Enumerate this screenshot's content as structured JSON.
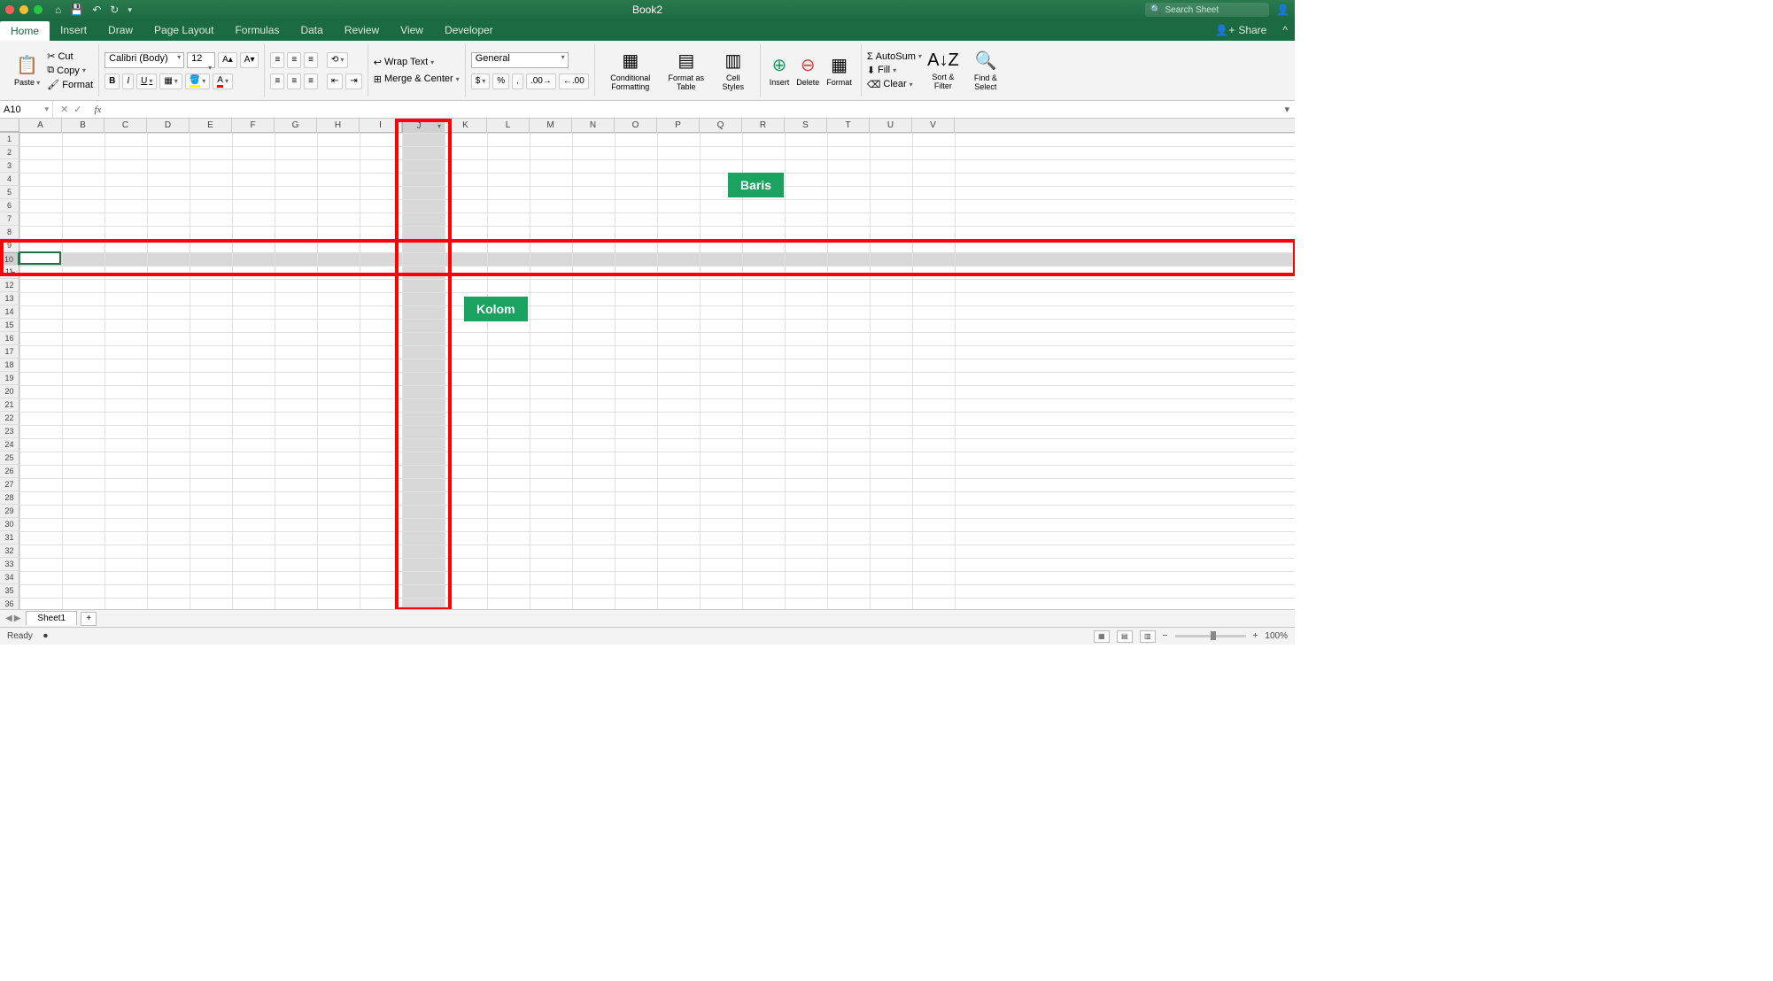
{
  "title": "Book2",
  "search_placeholder": "Search Sheet",
  "menu_tabs": [
    "Home",
    "Insert",
    "Draw",
    "Page Layout",
    "Formulas",
    "Data",
    "Review",
    "View",
    "Developer"
  ],
  "active_tab": "Home",
  "share_label": "Share",
  "clipboard": {
    "paste": "Paste",
    "cut": "Cut",
    "copy": "Copy",
    "format": "Format"
  },
  "font": {
    "name": "Calibri (Body)",
    "size": "12",
    "bold": "B",
    "italic": "I",
    "underline": "U"
  },
  "alignment": {
    "wrap": "Wrap Text",
    "merge": "Merge & Center"
  },
  "number": {
    "format": "General"
  },
  "styles": {
    "cond": "Conditional Formatting",
    "table": "Format as Table",
    "cell": "Cell Styles"
  },
  "cells_grp": {
    "insert": "Insert",
    "delete": "Delete",
    "format": "Format"
  },
  "editing": {
    "autosum": "AutoSum",
    "fill": "Fill",
    "clear": "Clear",
    "sort": "Sort & Filter",
    "find": "Find & Select"
  },
  "namebox": "A10",
  "fx": "fx",
  "columns": [
    "A",
    "B",
    "C",
    "D",
    "E",
    "F",
    "G",
    "H",
    "I",
    "J",
    "K",
    "L",
    "M",
    "N",
    "O",
    "P",
    "Q",
    "R",
    "S",
    "T",
    "U",
    "V"
  ],
  "highlighted_column": "J",
  "rows": 36,
  "highlighted_row": 10,
  "active_cell": "A10",
  "annotations": {
    "baris": "Baris",
    "kolom": "Kolom"
  },
  "sheet_name": "Sheet1",
  "status_text": "Ready",
  "zoom": "100%"
}
